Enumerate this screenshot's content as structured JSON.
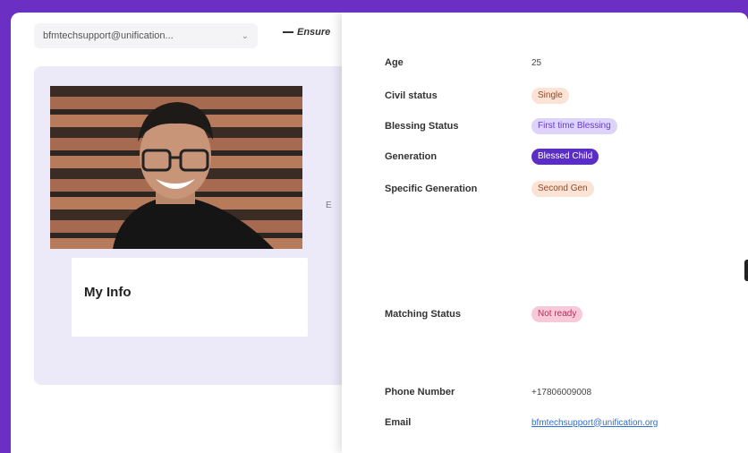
{
  "header": {
    "account_value": "bfmtechsupport@unification...",
    "ensure_label": "Ensure"
  },
  "left": {
    "card_title": "My Info",
    "side_mark": "E"
  },
  "details": {
    "age": {
      "label": "Age",
      "value": "25"
    },
    "civil_status": {
      "label": "Civil status",
      "value": "Single"
    },
    "blessing_status": {
      "label": "Blessing Status",
      "value": "First time Blessing"
    },
    "generation": {
      "label": "Generation",
      "value": "Blessed Child"
    },
    "specific_generation": {
      "label": "Specific Generation",
      "value": "Second Gen"
    },
    "matching_status": {
      "label": "Matching Status",
      "value": "Not ready"
    },
    "phone": {
      "label": "Phone Number",
      "value": "+17806009008"
    },
    "email": {
      "label": "Email",
      "value": "bfmtechsupport@unification.org"
    }
  },
  "colors": {
    "frame_bg": "#6b2fc4",
    "accent_purple": "#5a2ec4",
    "link_blue": "#2f6fd1"
  }
}
